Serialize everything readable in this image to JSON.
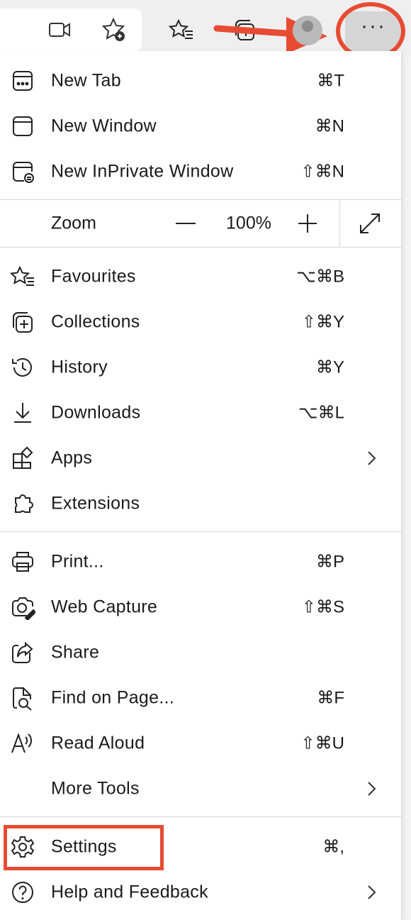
{
  "toolbar": {
    "icons": [
      "video-icon",
      "add-favourite-icon",
      "favourites-icon",
      "collections-icon",
      "profile-avatar",
      "more-icon"
    ],
    "more_label": "···"
  },
  "menu": {
    "group1": [
      {
        "label": "New Tab",
        "shortcut": "⌘T",
        "icon": "new-tab-icon"
      },
      {
        "label": "New Window",
        "shortcut": "⌘N",
        "icon": "new-window-icon"
      },
      {
        "label": "New InPrivate Window",
        "shortcut": "⇧⌘N",
        "icon": "inprivate-icon"
      }
    ],
    "zoom": {
      "label": "Zoom",
      "value": "100%"
    },
    "group2": [
      {
        "label": "Favourites",
        "shortcut": "⌥⌘B",
        "icon": "favourites-icon"
      },
      {
        "label": "Collections",
        "shortcut": "⇧⌘Y",
        "icon": "collections-icon"
      },
      {
        "label": "History",
        "shortcut": "⌘Y",
        "icon": "history-icon"
      },
      {
        "label": "Downloads",
        "shortcut": "⌥⌘L",
        "icon": "download-icon"
      },
      {
        "label": "Apps",
        "shortcut": "",
        "icon": "apps-icon",
        "submenu": true
      },
      {
        "label": "Extensions",
        "shortcut": "",
        "icon": "extensions-icon"
      }
    ],
    "group3": [
      {
        "label": "Print...",
        "shortcut": "⌘P",
        "icon": "print-icon"
      },
      {
        "label": "Web Capture",
        "shortcut": "⇧⌘S",
        "icon": "web-capture-icon"
      },
      {
        "label": "Share",
        "shortcut": "",
        "icon": "share-icon"
      },
      {
        "label": "Find on Page...",
        "shortcut": "⌘F",
        "icon": "find-icon"
      },
      {
        "label": "Read Aloud",
        "shortcut": "⇧⌘U",
        "icon": "read-aloud-icon"
      },
      {
        "label": "More Tools",
        "shortcut": "",
        "icon": "",
        "submenu": true
      }
    ],
    "group4": [
      {
        "label": "Settings",
        "shortcut": "⌘,",
        "icon": "settings-icon"
      },
      {
        "label": "Help and Feedback",
        "shortcut": "",
        "icon": "help-icon",
        "submenu": true
      }
    ]
  },
  "annotations": {
    "color": "#e74c33"
  }
}
